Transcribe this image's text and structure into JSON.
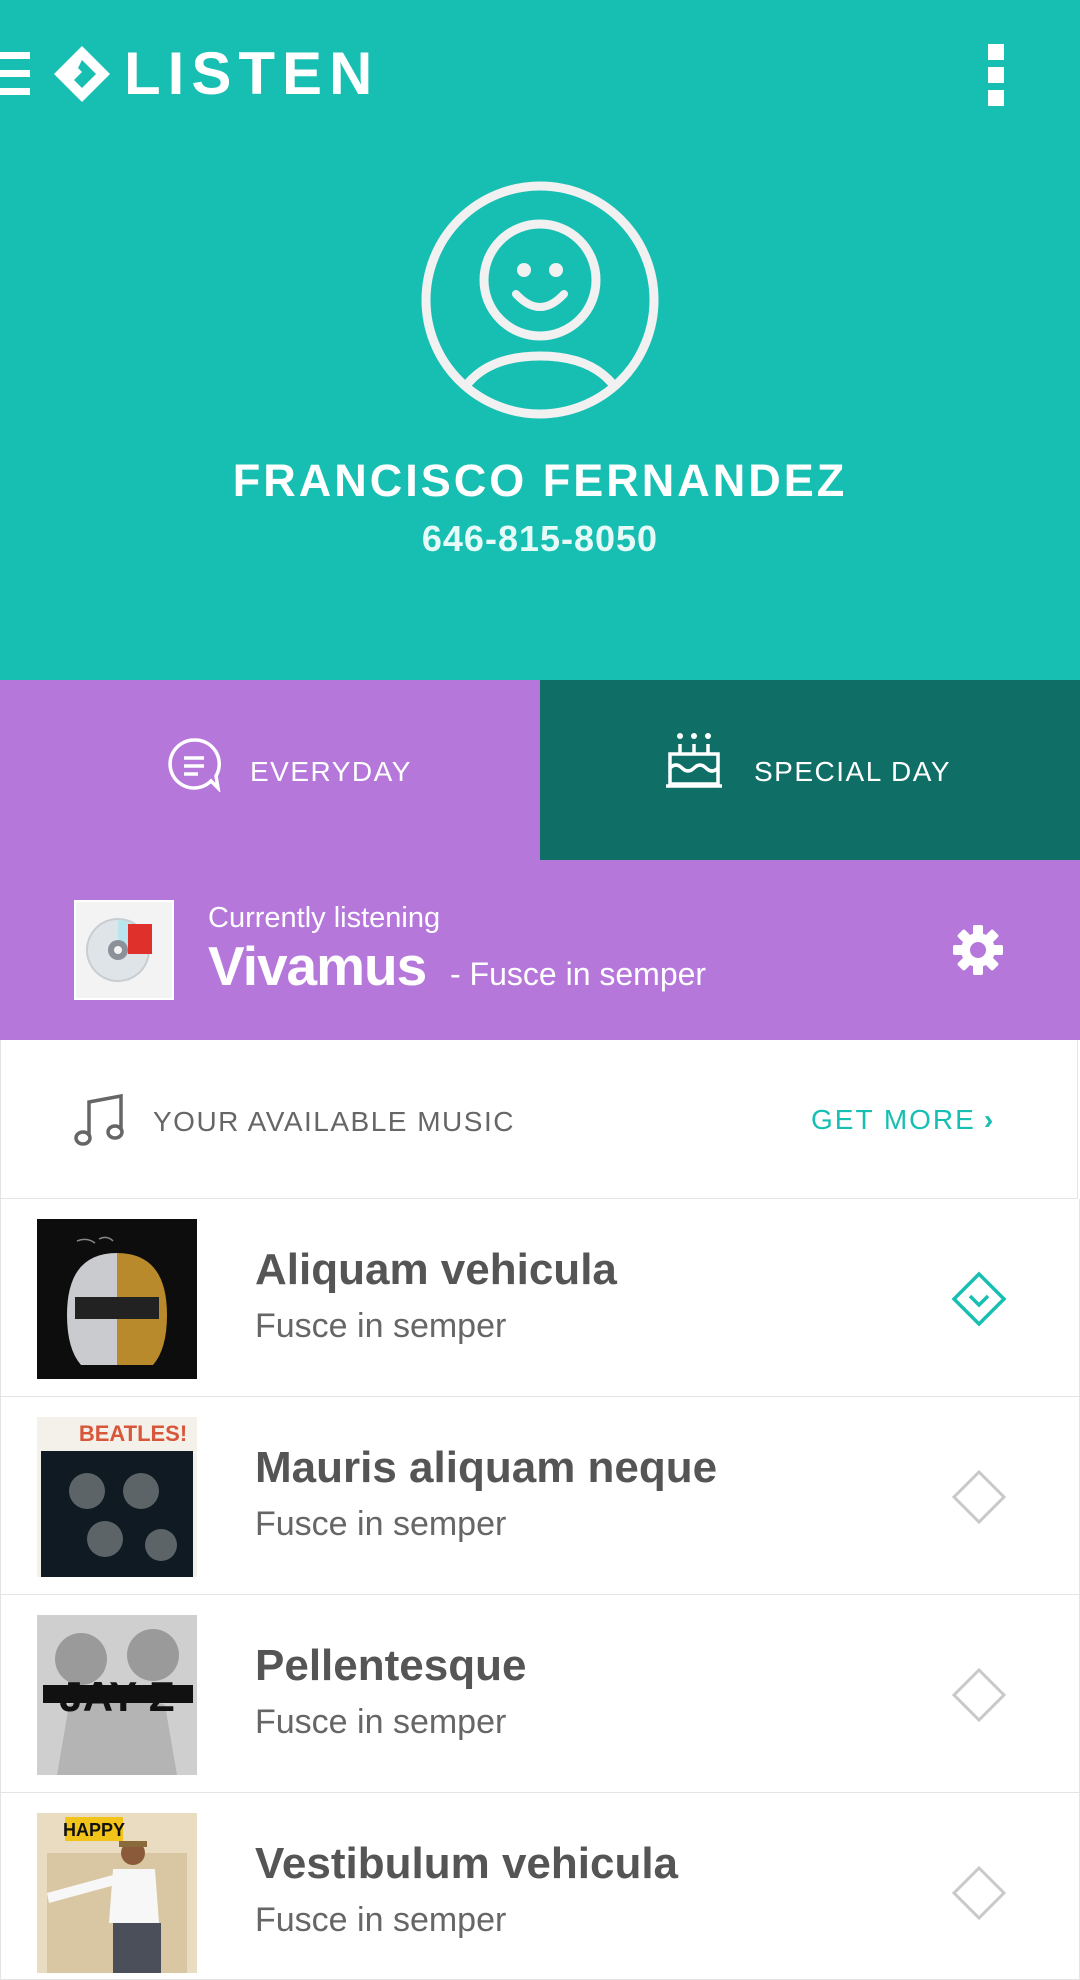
{
  "app": {
    "title": "LISTEN",
    "brand_color": "#17bfb2",
    "accent_purple": "#b578da",
    "accent_dark_teal": "#0f6f66"
  },
  "profile": {
    "name": "FRANCISCO FERNANDEZ",
    "phone": "646-815-8050"
  },
  "tabs": [
    {
      "label": "EVERYDAY",
      "icon": "chat-bubble-icon",
      "active": true
    },
    {
      "label": "SPECIAL DAY",
      "icon": "birthday-cake-icon",
      "active": false
    }
  ],
  "now_playing": {
    "label": "Currently listening",
    "title": "Vivamus",
    "subtitle": "- Fusce in semper"
  },
  "music": {
    "header": "YOUR AVAILABLE MUSIC",
    "get_more": "GET MORE"
  },
  "tracks": [
    {
      "title": "Aliquam vehicula",
      "artist": "Fusce in semper",
      "selected": true
    },
    {
      "title": "Mauris aliquam neque",
      "artist": "Fusce in semper",
      "selected": false,
      "cover_text": "BEATLES!"
    },
    {
      "title": "Pellentesque",
      "artist": "Fusce in semper",
      "selected": false,
      "cover_text": "JAY-Z"
    },
    {
      "title": "Vestibulum vehicula",
      "artist": "Fusce in semper",
      "selected": false,
      "cover_text": "HAPPY"
    }
  ]
}
